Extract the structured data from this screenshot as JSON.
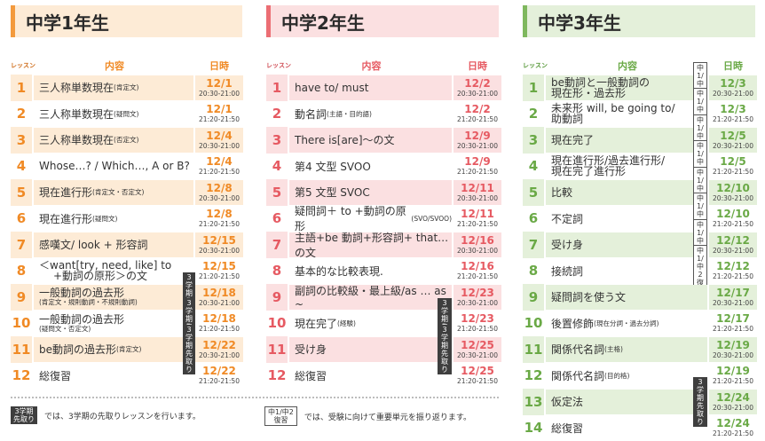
{
  "headers": {
    "lesson": "レッスン",
    "content": "内容",
    "date": "日時"
  },
  "badges": {
    "advance": [
      "3学期",
      "先取り"
    ],
    "review": [
      "中1/中2",
      "復習"
    ]
  },
  "columns": [
    {
      "title": "中学1年生",
      "rows": [
        {
          "num": "1",
          "text": "三人称単数現在",
          "note": "(肯定文)",
          "date": "12/1",
          "time": "20:30-21:00"
        },
        {
          "num": "2",
          "text": "三人称単数現在",
          "note": "(疑問文)",
          "date": "12/1",
          "time": "21:20-21:50"
        },
        {
          "num": "3",
          "text": "三人称単数現在",
          "note": "(否定文)",
          "date": "12/4",
          "time": "20:30-21:00"
        },
        {
          "num": "4",
          "text": "Whose…? / Which…, A or B?",
          "date": "12/4",
          "time": "21:20-21:50"
        },
        {
          "num": "5",
          "text": "現在進行形",
          "note": "(肯定文・否定文)",
          "date": "12/8",
          "time": "20:30-21:00"
        },
        {
          "num": "6",
          "text": "現在進行形",
          "note": "(疑問文)",
          "date": "12/8",
          "time": "21:20-21:50"
        },
        {
          "num": "7",
          "text": "感嘆文/ look + 形容詞",
          "date": "12/15",
          "time": "20:30-21:00"
        },
        {
          "num": "8",
          "text": "＜want[try, need, like] to",
          "line2": "+動詞の原形＞の文",
          "date": "12/15",
          "time": "21:20-21:50"
        },
        {
          "num": "9",
          "text": "一般動詞の過去形",
          "sub": "(肯定文・規則動詞・不規則動詞)",
          "badge": "advance",
          "date": "12/18",
          "time": "20:30-21:00"
        },
        {
          "num": "10",
          "text": "一般動詞の過去形",
          "sub": "(疑問文・否定文)",
          "badge": "advance",
          "date": "12/18",
          "time": "21:20-21:50"
        },
        {
          "num": "11",
          "text": "be動詞の過去形",
          "note": "(肯定文)",
          "badge": "advance",
          "date": "12/22",
          "time": "20:30-21:00"
        },
        {
          "num": "12",
          "text": "総復習",
          "date": "12/22",
          "time": "21:20-21:50"
        }
      ]
    },
    {
      "title": "中学2年生",
      "rows": [
        {
          "num": "1",
          "text": "have to/ must",
          "date": "12/2",
          "time": "20:30-21:00"
        },
        {
          "num": "2",
          "text": "動名詞",
          "note": "(主語・目的語)",
          "date": "12/2",
          "time": "21:20-21:50"
        },
        {
          "num": "3",
          "text": " There is[are]～の文",
          "date": "12/9",
          "time": "20:30-21:00"
        },
        {
          "num": "4",
          "text": "第4 文型 SVOO",
          "date": "12/9",
          "time": "21:20-21:50"
        },
        {
          "num": "5",
          "text": "第5 文型 SVOC",
          "date": "12/11",
          "time": "20:30-21:00"
        },
        {
          "num": "6",
          "text": "疑問詞＋ to +動詞の原形",
          "note": "(SVO/SVOO)",
          "date": "12/11",
          "time": "21:20-21:50"
        },
        {
          "num": "7",
          "text": "主語+be 動詞+形容詞+ that…の文",
          "date": "12/16",
          "time": "20:30-21:00"
        },
        {
          "num": "8",
          "text": "基本的な比較表現.",
          "date": "12/16",
          "time": "21:20-21:50"
        },
        {
          "num": "9",
          "text": "副詞の比較級・最上級/as … as ~",
          "date": "12/23",
          "time": "20:30-21:00"
        },
        {
          "num": "10",
          "text": "現在完了",
          "note": "(経験)",
          "badge": "advance",
          "date": "12/23",
          "time": "21:20-21:50"
        },
        {
          "num": "11",
          "text": "受け身",
          "badge": "advance",
          "date": "12/25",
          "time": "20:30-21:00"
        },
        {
          "num": "12",
          "text": "総復習",
          "date": "12/25",
          "time": "21:20-21:50"
        }
      ]
    },
    {
      "title": "中学3年生",
      "rows": [
        {
          "num": "1",
          "text": "be動詞と一般動詞の",
          "line2": "現在形・過去形",
          "badge": "review",
          "date": "12/3",
          "time": "20:30-21:00"
        },
        {
          "num": "2",
          "text": "未来形 will, be going to/",
          "line2": "助動詞",
          "badge": "review",
          "date": "12/3",
          "time": "21:20-21:50"
        },
        {
          "num": "3",
          "text": "現在完了",
          "badge": "review",
          "date": "12/5",
          "time": "20:30-21:00"
        },
        {
          "num": "4",
          "text": "現在進行形/過去進行形/",
          "line2": "現在完了進行形",
          "badge": "review",
          "date": "12/5",
          "time": "21:20-21:50"
        },
        {
          "num": "5",
          "text": "比較",
          "badge": "review",
          "date": "12/10",
          "time": "20:30-21:00"
        },
        {
          "num": "6",
          "text": "不定詞",
          "badge": "review",
          "date": "12/10",
          "time": "21:20-21:50"
        },
        {
          "num": "7",
          "text": "受け身",
          "badge": "review",
          "date": "12/12",
          "time": "20:30-21:00"
        },
        {
          "num": "8",
          "text": "接続詞",
          "badge": "review",
          "date": "12/12",
          "time": "21:20-21:50"
        },
        {
          "num": "9",
          "text": "疑問詞を使う文",
          "date": "12/17",
          "time": "20:30-21:00"
        },
        {
          "num": "10",
          "text": "後置修飾",
          "note": "(現在分詞・過去分詞)",
          "date": "12/17",
          "time": "21:20-21:50"
        },
        {
          "num": "11",
          "text": "関係代名詞",
          "note": "(主格)",
          "date": "12/19",
          "time": "20:30-21:00"
        },
        {
          "num": "12",
          "text": "関係代名詞",
          "note": "(目的格)",
          "date": "12/19",
          "time": "21:20-21:50"
        },
        {
          "num": "13",
          "text": "仮定法",
          "badge": "advance",
          "date": "12/24",
          "time": "20:30-21:00"
        },
        {
          "num": "14",
          "text": " 総復習",
          "date": "12/24",
          "time": "21:20-21:50"
        }
      ]
    }
  ],
  "legend": {
    "advance_text": "では、3学期の先取りレッスンを行います。",
    "review_text": "では、受験に向けて重要単元を振り返ります。"
  },
  "colors": {
    "grade1": "#f08a25",
    "grade2": "#e65a62",
    "grade3": "#6aa946"
  }
}
